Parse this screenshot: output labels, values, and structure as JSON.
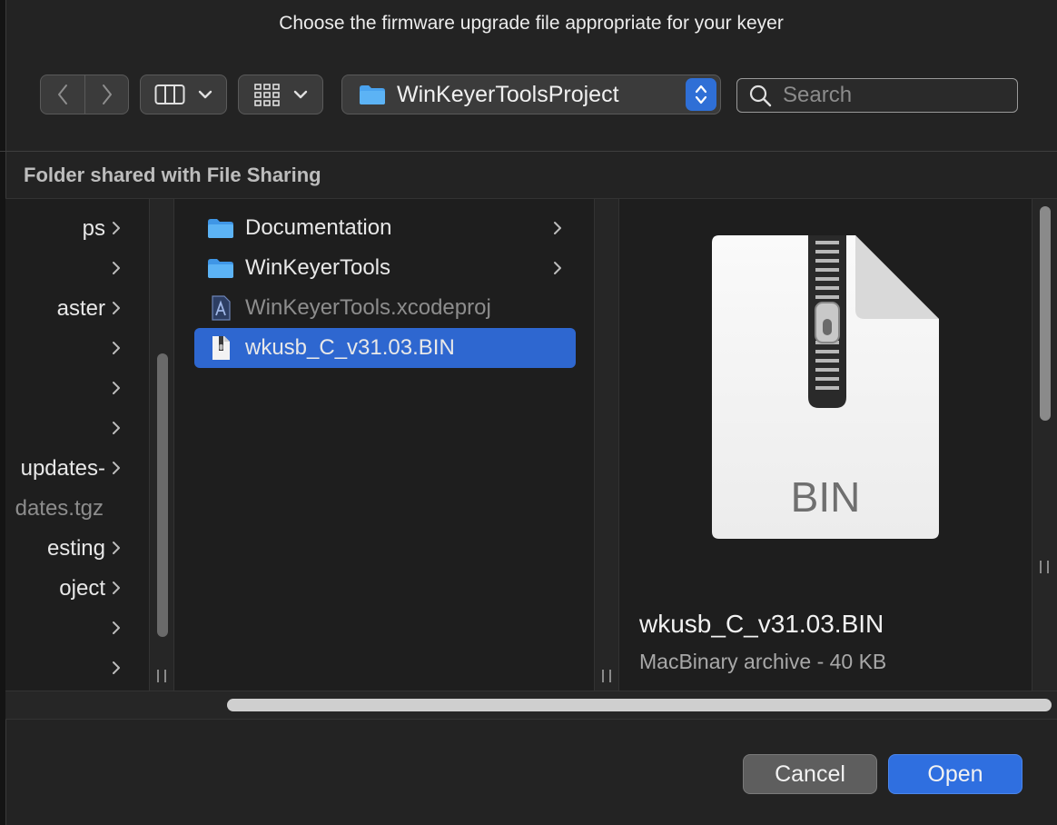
{
  "dialog": {
    "title": "Choose the firmware upgrade file appropriate for your keyer"
  },
  "toolbar": {
    "back_icon": "chevron-left-icon",
    "forward_icon": "chevron-right-icon",
    "view_mode_icon": "column-view-icon",
    "group_icon": "grid-group-icon",
    "path_label": "WinKeyerToolsProject",
    "search_placeholder": "Search"
  },
  "sidebar_header": "Folder shared with File Sharing",
  "column1": {
    "items": [
      {
        "label": "ps",
        "has_children": true
      },
      {
        "label": "",
        "has_children": true
      },
      {
        "label": "aster",
        "has_children": true
      },
      {
        "label": "",
        "has_children": true
      },
      {
        "label": "",
        "has_children": true
      },
      {
        "label": "",
        "has_children": true
      },
      {
        "label": "-updates",
        "has_children": true
      },
      {
        "label": "dates.tgz",
        "has_children": false,
        "dimmed": true
      },
      {
        "label": "esting",
        "has_children": true
      },
      {
        "label": "oject",
        "has_children": true
      },
      {
        "label": "",
        "has_children": true
      },
      {
        "label": "",
        "has_children": true
      }
    ]
  },
  "column2": {
    "items": [
      {
        "name": "Documentation",
        "type": "folder",
        "has_children": true
      },
      {
        "name": "WinKeyerTools",
        "type": "folder",
        "has_children": true
      },
      {
        "name": "WinKeyerTools.xcodeproj",
        "type": "xcodeproj",
        "has_children": false,
        "dimmed": true
      },
      {
        "name": "wkusb_C_v31.03.BIN",
        "type": "archive",
        "has_children": false,
        "selected": true
      }
    ]
  },
  "preview": {
    "icon_label": "BIN",
    "file_name": "wkusb_C_v31.03.BIN",
    "file_info": "MacBinary archive - 40 KB"
  },
  "buttons": {
    "cancel": "Cancel",
    "open": "Open"
  },
  "colors": {
    "accent": "#2f6fe0",
    "selection": "#2e67d0",
    "folder": "#4aa3ef",
    "background": "#1e1e1e"
  }
}
